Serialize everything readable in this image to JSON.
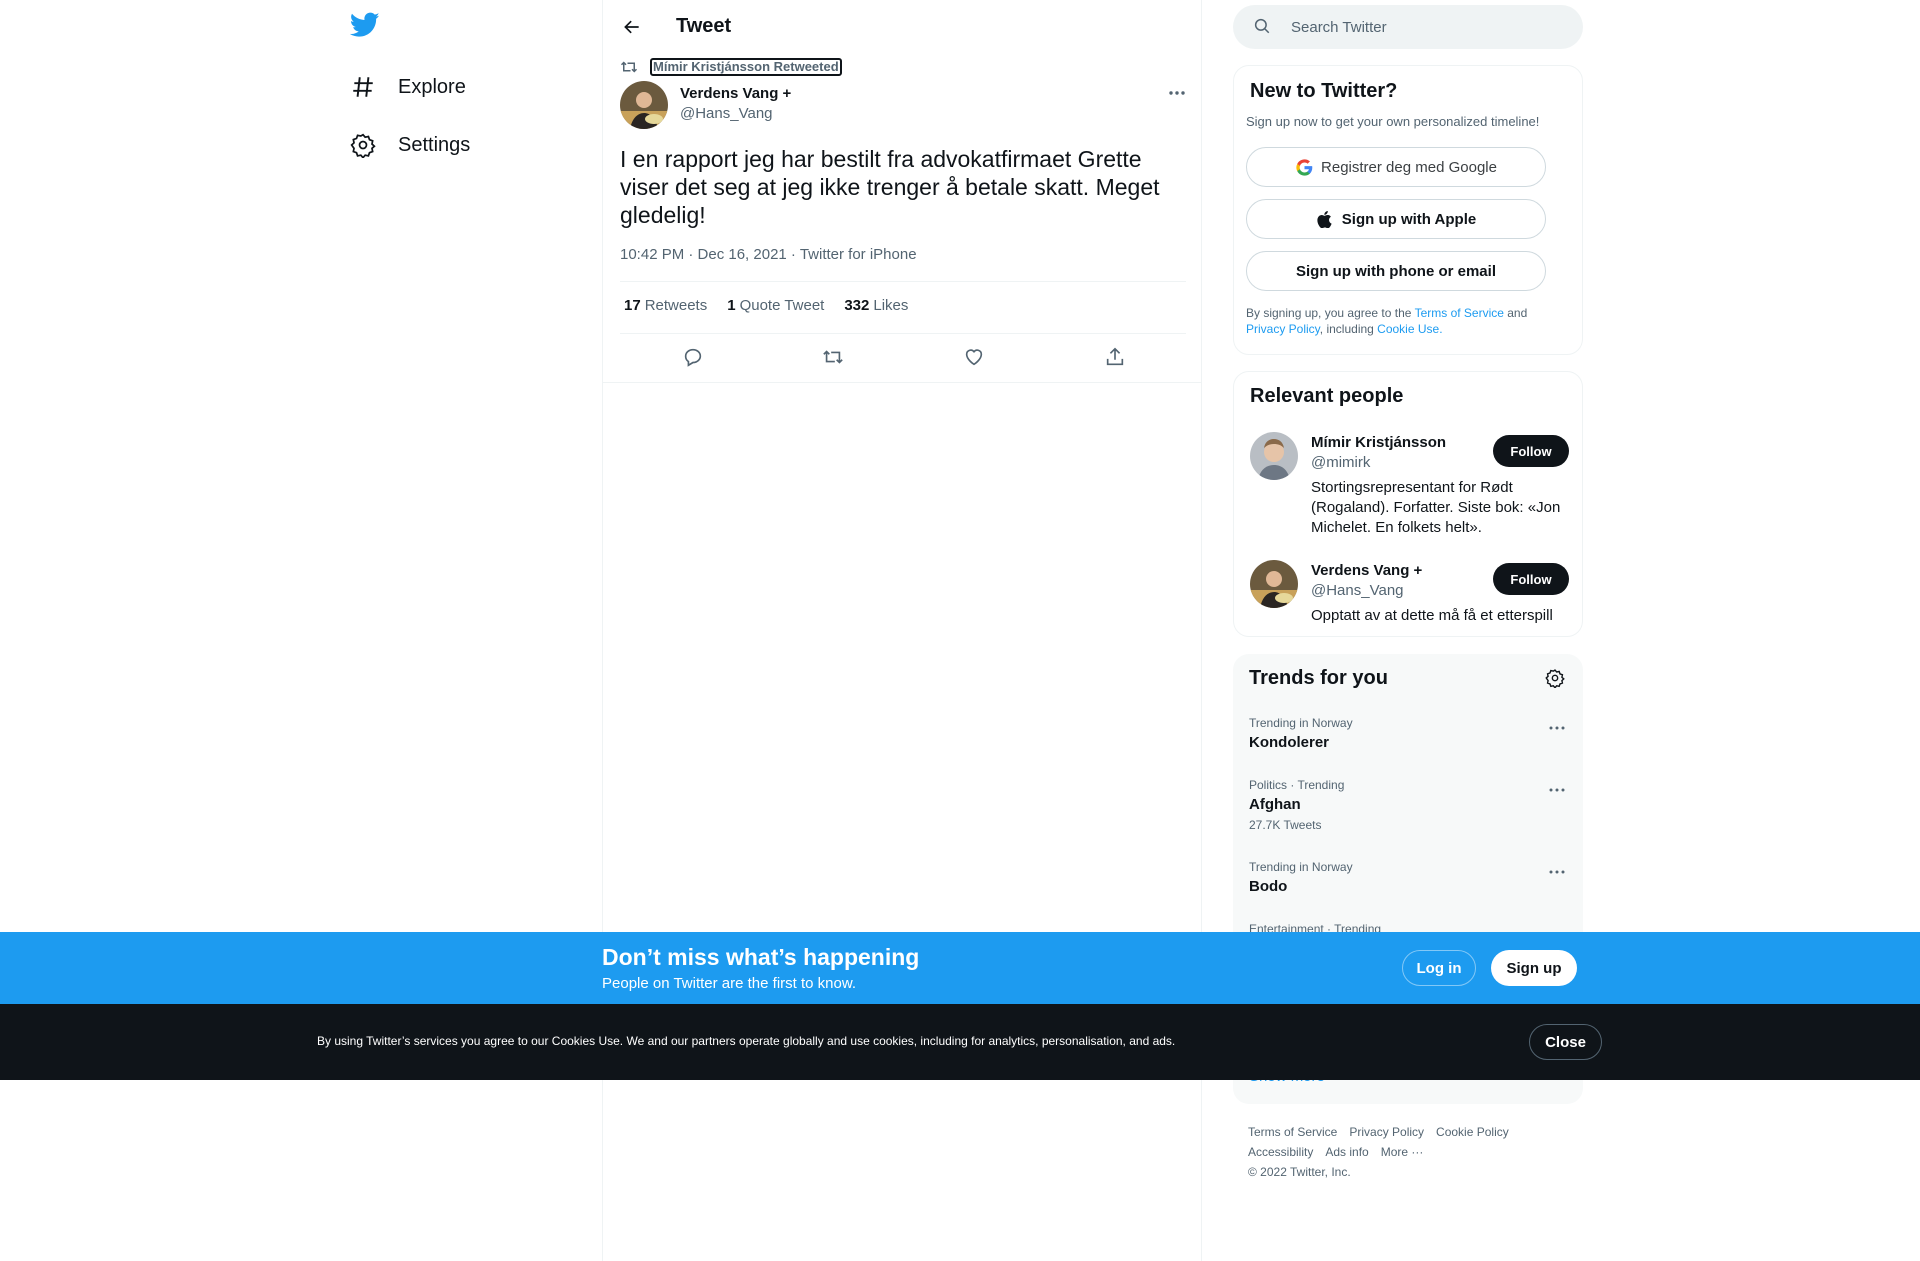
{
  "colors": {
    "accent": "#1d9bf0",
    "text": "#0f1419",
    "muted": "#536471",
    "dark": "#0f1419"
  },
  "nav": {
    "items": [
      {
        "label": "Explore",
        "icon": "hashtag-icon"
      },
      {
        "label": "Settings",
        "icon": "gear-icon"
      }
    ]
  },
  "header": {
    "title": "Tweet"
  },
  "tweet": {
    "retweeted_by": "Mímir Kristjánsson Retweeted",
    "author_name": "Verdens Vang +",
    "author_handle": "@Hans_Vang",
    "text": "I en rapport jeg har bestilt fra advokatfirmaet Grette viser det seg at jeg ikke trenger å betale skatt. Meget gledelig!",
    "meta": "10:42 PM · Dec 16, 2021 · Twitter for iPhone",
    "stats": [
      {
        "num": "17",
        "label": "Retweets"
      },
      {
        "num": "1",
        "label": "Quote Tweet"
      },
      {
        "num": "332",
        "label": "Likes"
      }
    ]
  },
  "search": {
    "placeholder": "Search Twitter"
  },
  "new_to_twitter": {
    "title": "New to Twitter?",
    "subtitle": "Sign up now to get your own personalized timeline!",
    "google_label": "Registrer deg med Google",
    "apple_label": "Sign up with Apple",
    "phone_label": "Sign up with phone or email",
    "legal_prefix": "By signing up, you agree to the ",
    "terms": "Terms of Service",
    "and": " and ",
    "privacy": "Privacy Policy",
    "including": ", including ",
    "cookie": "Cookie Use."
  },
  "relevant_people": {
    "title": "Relevant people",
    "people": [
      {
        "name": "Mímir Kristjánsson",
        "handle": "@mimirk",
        "bio": "Stortingsrepresentant for Rødt (Rogaland). Forfatter. Siste bok: «Jon Michelet. En folkets helt».",
        "follow": "Follow"
      },
      {
        "name": "Verdens Vang +",
        "handle": "@Hans_Vang",
        "bio": "Opptatt av at dette må få et etterspill",
        "follow": "Follow"
      }
    ]
  },
  "trends": {
    "title": "Trends for you",
    "items": [
      {
        "meta": "Trending in Norway",
        "name": "Kondolerer",
        "count": ""
      },
      {
        "meta": "Politics · Trending",
        "name": "Afghan",
        "count": "27.7K Tweets"
      },
      {
        "meta": "Trending in Norway",
        "name": "Bodo",
        "count": ""
      },
      {
        "meta": "Entertainment · Trending",
        "name": "",
        "count": ""
      }
    ],
    "show_more": "Show more"
  },
  "footer": {
    "links_row1": [
      "Terms of Service",
      "Privacy Policy",
      "Cookie Policy"
    ],
    "links_row2": [
      "Accessibility",
      "Ads info",
      "More ···"
    ],
    "copyright": "© 2022 Twitter, Inc."
  },
  "banner": {
    "title": "Don’t miss what’s happening",
    "subtitle": "People on Twitter are the first to know.",
    "login": "Log in",
    "signup": "Sign up"
  },
  "cookie_bar": {
    "text": "By using Twitter’s services you agree to our Cookies Use. We and our partners operate globally and use cookies, including for analytics, personalisation, and ads.",
    "close": "Close"
  }
}
